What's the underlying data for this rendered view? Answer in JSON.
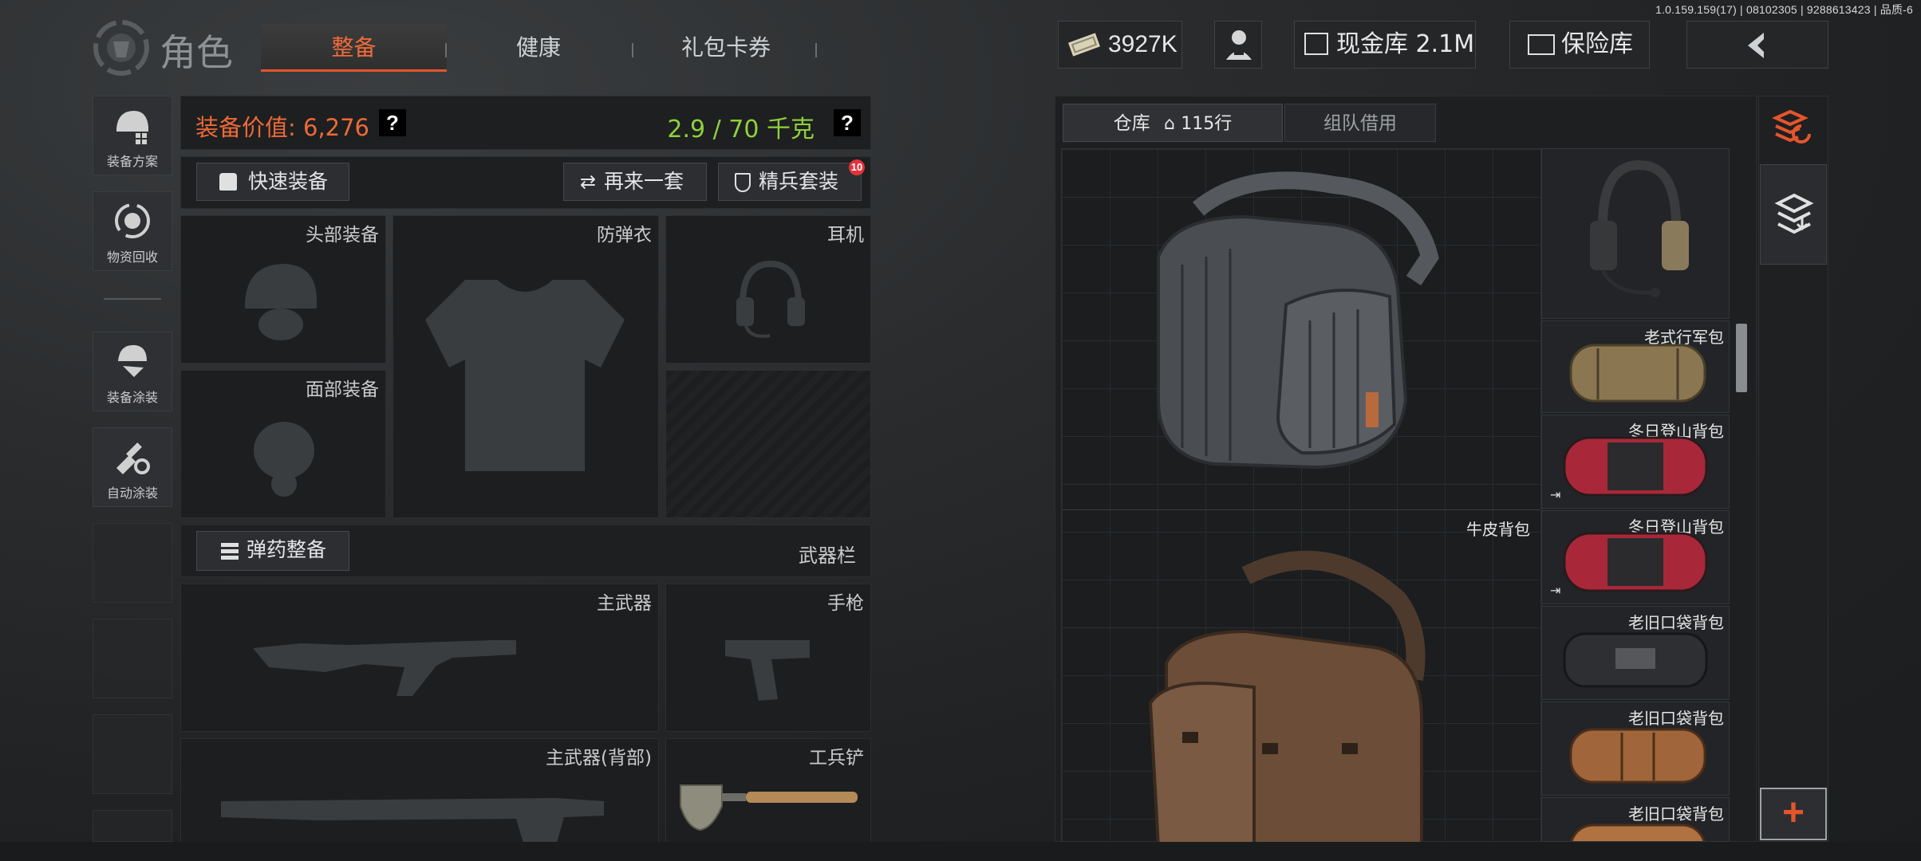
{
  "version": "1.0.159.159(17) | 08102305 | 9288613423 | 品质-6",
  "header": {
    "title": "角色",
    "tabs": [
      "整备",
      "健康",
      "礼包卡券"
    ],
    "money": "3927K",
    "cash_vault": "现金库 2.1M",
    "safe_box": "保险库"
  },
  "left_rail": {
    "items": [
      {
        "label": "装备方案",
        "icon": "helmet-plan-icon"
      },
      {
        "label": "物资回收",
        "icon": "recycle-icon"
      },
      {
        "label": "装备涂装",
        "icon": "paint-gear-icon"
      },
      {
        "label": "自动涂装",
        "icon": "auto-paint-icon"
      }
    ]
  },
  "equipment": {
    "value_label": "装备价值: 6,276",
    "weight_label": "2.9 / 70 千克",
    "help": "?",
    "quick_equip": "快速装备",
    "again": "再来一套",
    "elite_set": "精兵套装",
    "elite_badge": "10",
    "slots": {
      "head": "头部装备",
      "armor": "防弹衣",
      "headset": "耳机",
      "face": "面部装备"
    },
    "ammo_button": "弹药整备",
    "weapon_bar": "武器栏",
    "weapons": {
      "primary": "主武器",
      "pistol": "手枪",
      "primary_back": "主武器(背部)",
      "shovel": "工兵铲"
    }
  },
  "storage": {
    "tab_storage": "仓库",
    "rows": "115行",
    "tab_team": "组队借用",
    "big_items": [
      {
        "label": "牛皮背包"
      }
    ],
    "side_items": [
      {
        "label": "老式行军包"
      },
      {
        "label": "冬日登山背包"
      },
      {
        "label": "冬日登山背包"
      },
      {
        "label": "老旧口袋背包"
      },
      {
        "label": "老旧口袋背包"
      },
      {
        "label": "老旧口袋背包"
      }
    ]
  },
  "colors": {
    "accent": "#e5552c",
    "weight_green": "#8fd13a",
    "value_orange": "#ee6a36"
  }
}
